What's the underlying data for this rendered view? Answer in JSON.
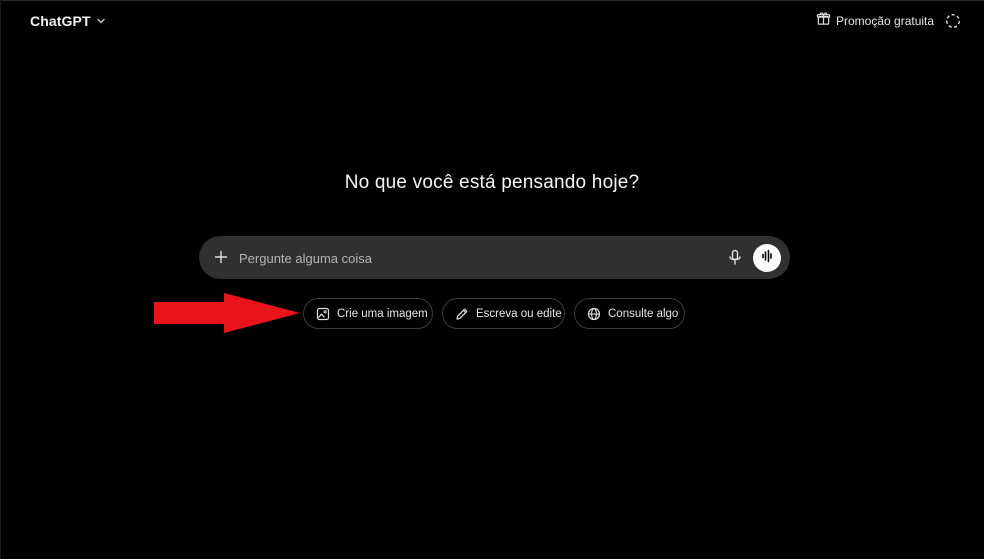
{
  "header": {
    "app_title": "ChatGPT",
    "promo_label": "Promoção gratuita"
  },
  "main": {
    "headline": "No que você está pensando hoje?",
    "composer": {
      "placeholder": "Pergunte alguma coisa"
    },
    "suggestions": [
      {
        "label": "Crie uma imagem",
        "icon": "image-icon"
      },
      {
        "label": "Escreva ou edite",
        "icon": "pencil-icon"
      },
      {
        "label": "Consulte algo",
        "icon": "globe-icon"
      }
    ]
  },
  "annotation": {
    "arrow_color": "#e8141b"
  },
  "colors": {
    "background": "#000000",
    "composer_bg": "#303030",
    "chip_border": "#3a3a3a"
  }
}
